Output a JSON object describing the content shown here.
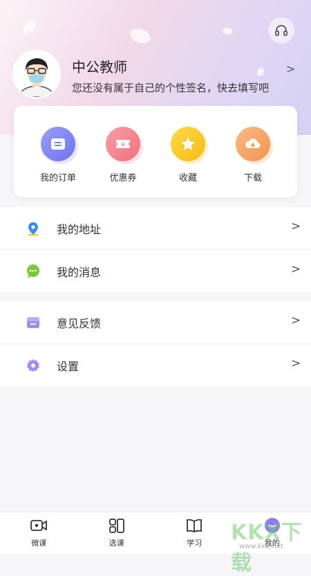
{
  "profile": {
    "name": "中公教师",
    "signature": "您还没有属于自己的个性签名，快去填写吧",
    "arrow": ">"
  },
  "quick_actions": [
    {
      "label": "我的订单",
      "icon": "order-icon",
      "color": "#7b7ff0"
    },
    {
      "label": "优惠券",
      "icon": "coupon-icon",
      "color": "#f27a88"
    },
    {
      "label": "收藏",
      "icon": "star-icon",
      "color": "#f7c92a"
    },
    {
      "label": "下载",
      "icon": "download-icon",
      "color": "#f4a160"
    }
  ],
  "menu_group_1": [
    {
      "label": "我的地址",
      "icon": "location-icon",
      "arrow": ">"
    },
    {
      "label": "我的消息",
      "icon": "message-icon",
      "arrow": ">"
    }
  ],
  "menu_group_2": [
    {
      "label": "意见反馈",
      "icon": "feedback-icon",
      "arrow": ">"
    },
    {
      "label": "设置",
      "icon": "settings-icon",
      "arrow": ">"
    }
  ],
  "tabs": [
    {
      "label": "微课",
      "icon": "video-icon"
    },
    {
      "label": "选课",
      "icon": "course-icon"
    },
    {
      "label": "学习",
      "icon": "book-icon"
    },
    {
      "label": "我的",
      "icon": "profile-icon",
      "active": true
    }
  ],
  "watermark": {
    "logo": "KKX下载",
    "url": "www.kkx.net"
  }
}
